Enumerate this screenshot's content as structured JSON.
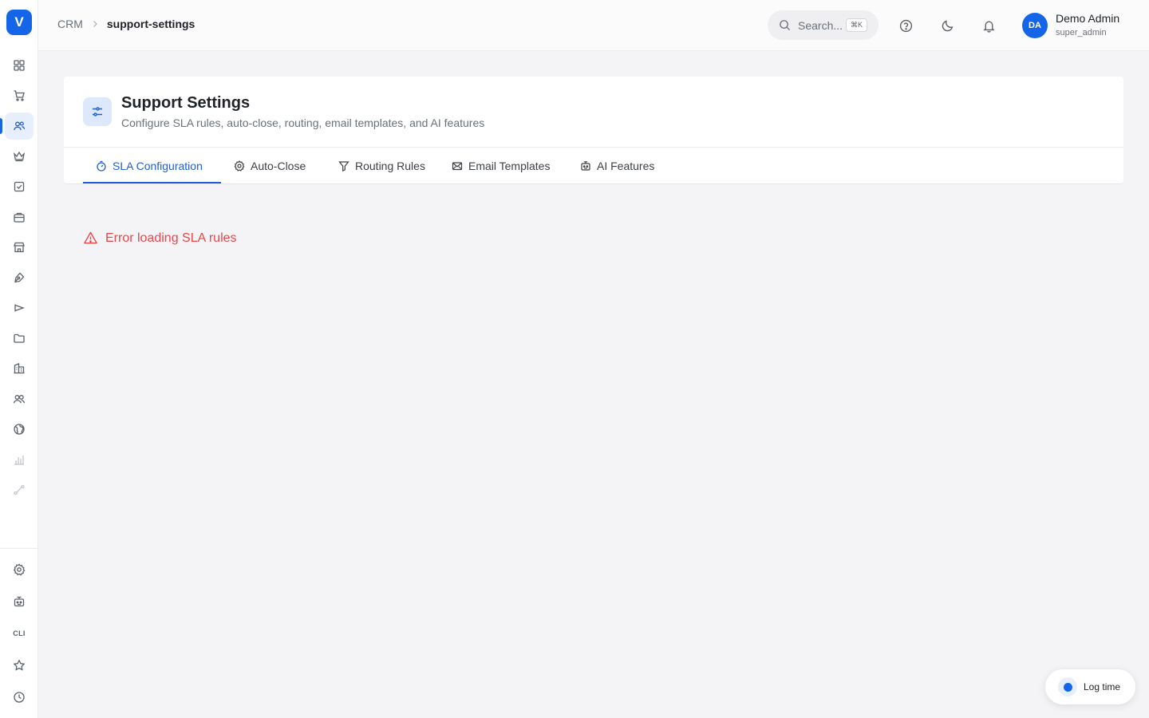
{
  "app": {
    "logo_letter": "V",
    "brand_color": "#1565e8"
  },
  "sidebar": {
    "items": [
      {
        "icon": "grid-icon"
      },
      {
        "icon": "cart-icon"
      },
      {
        "icon": "users-icon",
        "active": true
      },
      {
        "icon": "crown-icon"
      },
      {
        "icon": "checkbox-icon"
      },
      {
        "icon": "briefcase-icon"
      },
      {
        "icon": "store-icon"
      },
      {
        "icon": "pen-tool-icon"
      },
      {
        "icon": "megaphone-icon"
      },
      {
        "icon": "folder-icon"
      },
      {
        "icon": "building-icon"
      },
      {
        "icon": "team-icon"
      },
      {
        "icon": "globe-icon"
      },
      {
        "icon": "bar-chart-icon"
      },
      {
        "icon": "route-icon"
      }
    ],
    "bottom_items": [
      {
        "icon": "settings-icon"
      },
      {
        "icon": "bot-icon"
      },
      {
        "label": "CLI"
      },
      {
        "icon": "star-icon"
      },
      {
        "icon": "clock-icon"
      }
    ]
  },
  "header": {
    "breadcrumb": {
      "root": "CRM",
      "current": "support-settings"
    },
    "search": {
      "placeholder": "Search...",
      "shortcut": "⌘K"
    },
    "user": {
      "initials": "DA",
      "name": "Demo Admin",
      "role": "super_admin"
    }
  },
  "page": {
    "title": "Support Settings",
    "subtitle": "Configure SLA rules, auto-close, routing, email templates, and AI features",
    "tabs": [
      {
        "label": "SLA Configuration",
        "icon": "timer-icon",
        "active": true
      },
      {
        "label": "Auto-Close",
        "icon": "gear-icon"
      },
      {
        "label": "Routing Rules",
        "icon": "filter-icon"
      },
      {
        "label": "Email Templates",
        "icon": "mail-icon"
      },
      {
        "label": "AI Features",
        "icon": "bot-icon"
      }
    ],
    "error": "Error loading SLA rules",
    "error_color": "#e5484d"
  },
  "floating": {
    "log_time_label": "Log time"
  }
}
